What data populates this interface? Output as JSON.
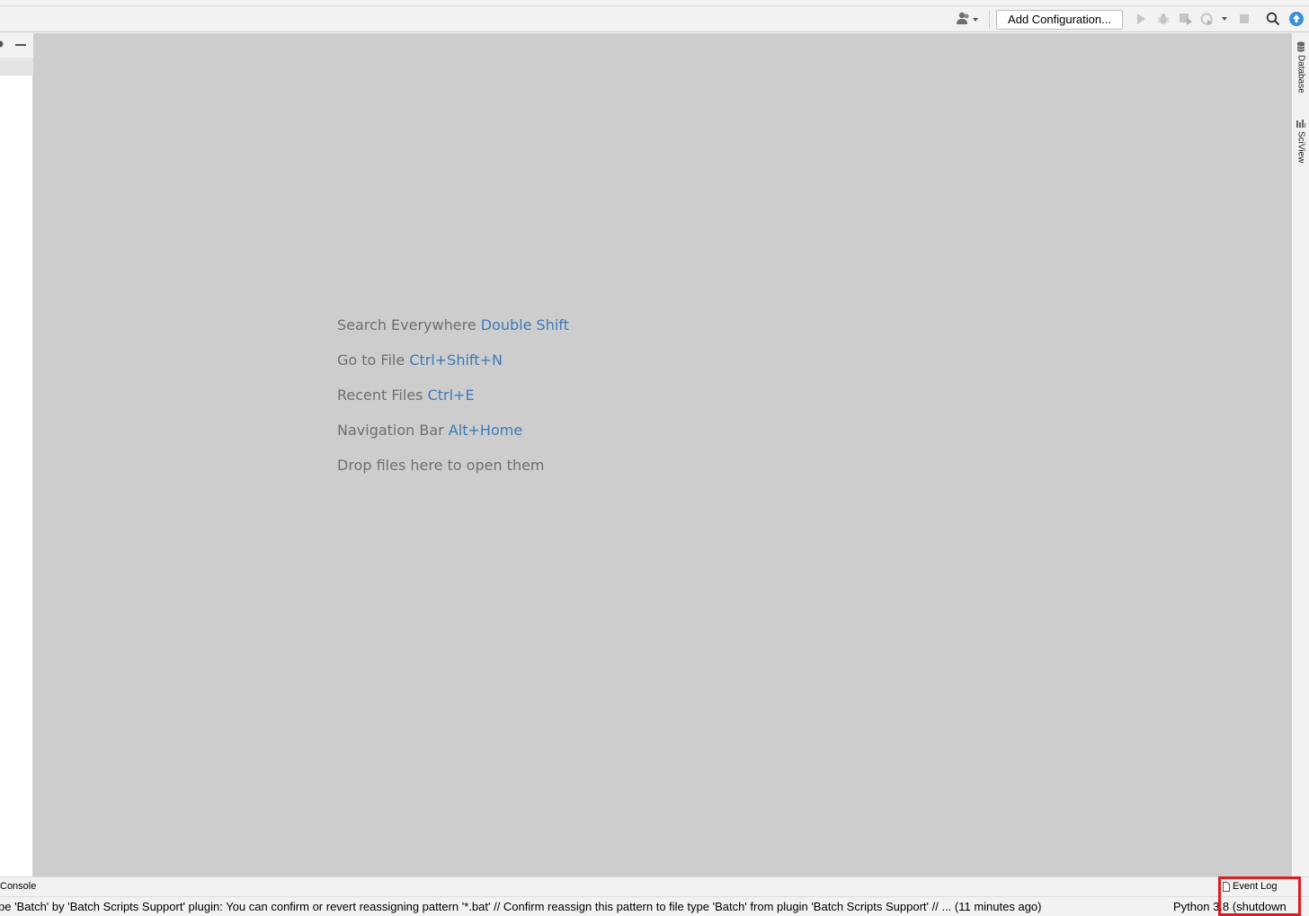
{
  "toolbar": {
    "add_configuration_label": "Add Configuration...",
    "icons": [
      "user-icon",
      "run-icon",
      "debug-icon",
      "coverage-icon",
      "profile-icon",
      "stop-icon",
      "search-icon",
      "update-icon"
    ]
  },
  "editor": {
    "hints": [
      {
        "text": "Search Everywhere",
        "shortcut": "Double Shift"
      },
      {
        "text": "Go to File",
        "shortcut": "Ctrl+Shift+N"
      },
      {
        "text": "Recent Files",
        "shortcut": "Ctrl+E"
      },
      {
        "text": "Navigation Bar",
        "shortcut": "Alt+Home"
      },
      {
        "text": "Drop files here to open them",
        "shortcut": ""
      }
    ]
  },
  "right_strip": {
    "tabs": [
      {
        "label": "Database",
        "icon": "database-icon"
      },
      {
        "label": "SciView",
        "icon": "sciview-icon"
      }
    ]
  },
  "bottom_bar": {
    "console_label": "Console",
    "event_log_label": "Event Log"
  },
  "status_bar": {
    "message": "pe 'Batch' by 'Batch Scripts Support' plugin: You can confirm or revert reassigning pattern '*.bat' // Confirm reassign this pattern to file type 'Batch' from plugin 'Batch Scripts Support' // ... (11 minutes ago)",
    "interpreter": "Python 3.8 (shutdown"
  },
  "colors": {
    "editor_background": "#cdcdcd",
    "hint_text": "#6f6f6f",
    "shortcut_text": "#3e79b8",
    "highlight_box": "#e01b24"
  }
}
